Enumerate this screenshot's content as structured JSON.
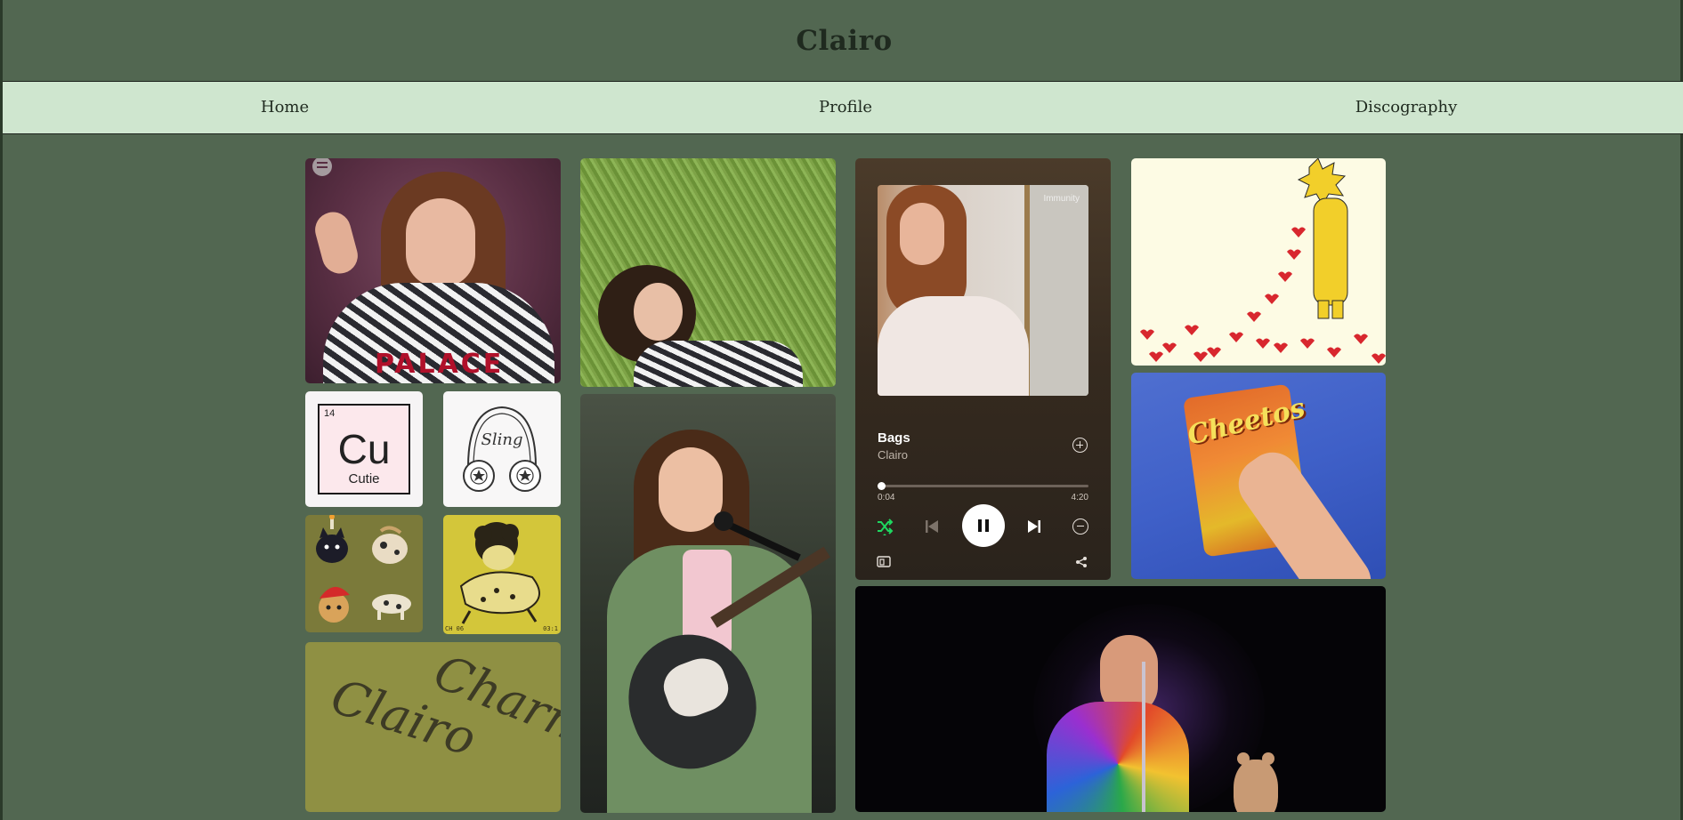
{
  "site": {
    "title": "Clairo"
  },
  "nav": {
    "items": [
      {
        "label": "Home"
      },
      {
        "label": "Profile"
      },
      {
        "label": "Discography"
      }
    ]
  },
  "gallery": {
    "photo_palace": {
      "shirt_text": "PALACE",
      "icon": "spotify-icon"
    },
    "sticker_element": {
      "number": "14",
      "symbol": "Cu",
      "name": "Cutie"
    },
    "sticker_sling": {
      "text": "Sling"
    },
    "photo_chart": {
      "caption_left": "CH 06",
      "caption_right": "03:1"
    },
    "sticker_charm": {
      "line1": "Clairo",
      "line2": "Charm"
    },
    "photo_cheetos": {
      "brand": "Cheetos"
    }
  },
  "player": {
    "art_watermark": "Immunity",
    "song_title": "Bags",
    "artist": "Clairo",
    "elapsed": "0:04",
    "duration": "4:20",
    "progress_fraction": 0.0154,
    "accent_color": "#1ed760",
    "shuffle_on": true,
    "is_playing": true,
    "icons": [
      "add-icon",
      "shuffle-icon",
      "previous-icon",
      "pause-icon",
      "next-icon",
      "remove-icon",
      "devices-icon",
      "share-icon"
    ]
  }
}
